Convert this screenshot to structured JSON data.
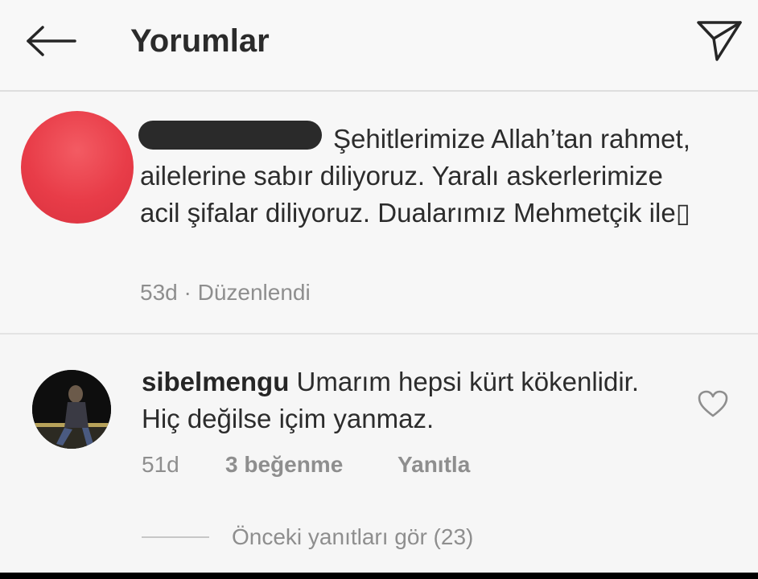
{
  "header": {
    "title": "Yorumlar",
    "back_icon": "arrow-left-icon",
    "send_icon": "paper-plane-icon"
  },
  "post_caption": {
    "username": "",
    "text": "Şehitlerimize Allah’tan rahmet, ailelerine sabır diliyoruz. Yaralı askerlerimize acil şifalar diliyoruz. Dualarımız Mehmetçik ile",
    "trailing_glyph": "▯",
    "time": "53d",
    "edited_label": "· Düzenlendi",
    "avatar_color": "#e83c48"
  },
  "reply": {
    "username": "sibelmengu",
    "text": "Umarım hepsi kürt kökenlidir. Hiç değilse içim yanmaz.",
    "time": "51d",
    "likes_label": "3 beğenme",
    "reply_label": "Yanıtla",
    "like_icon": "heart-icon"
  },
  "view_previous_replies": {
    "label": "Önceki yanıtları gör (23)"
  },
  "colors": {
    "text": "#262626",
    "secondary": "#8e8e8e",
    "background": "#f7f7f7"
  }
}
